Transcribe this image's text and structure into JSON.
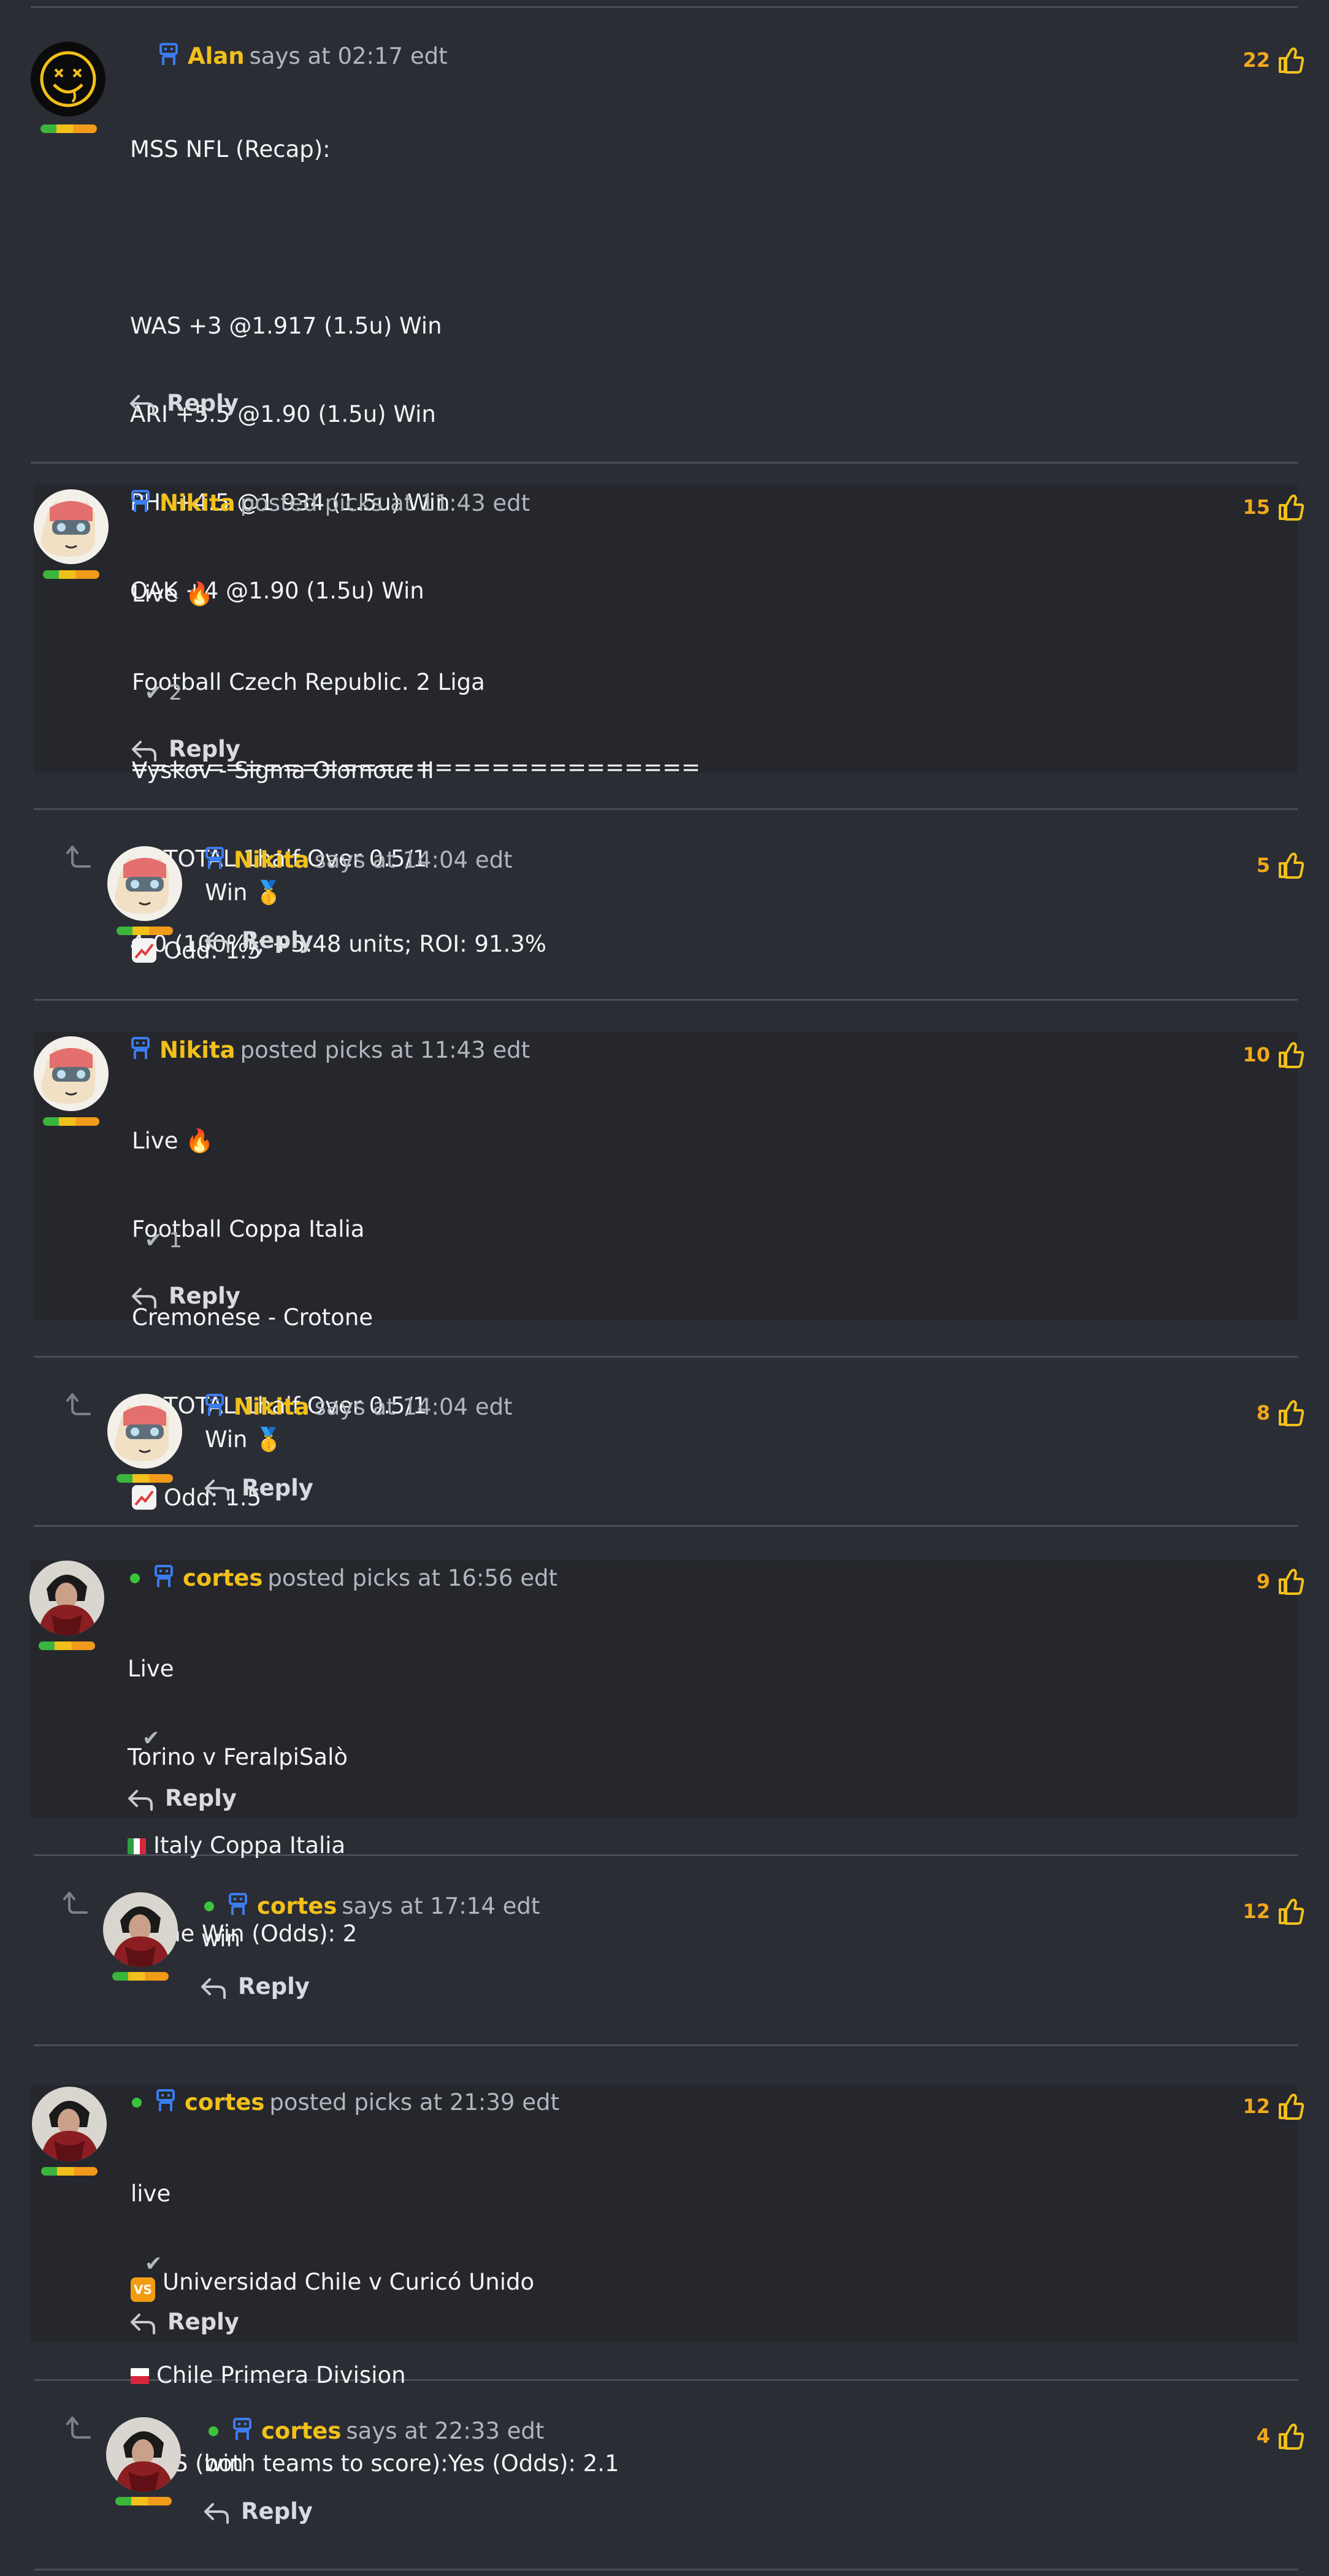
{
  "colors": {
    "background": "#2b2d35",
    "panel": "#25272d",
    "username": "#f2c01a",
    "likes": "#f2a81a",
    "online": "#3bc43b"
  },
  "icons": {
    "reply": "reply-arrow-icon",
    "like": "thumbs-up-icon",
    "bot": "robot-icon",
    "nested": "nested-reply-arrow-icon",
    "check": "checkmark-icon"
  },
  "comments": [
    {
      "user": "Alan",
      "action": "says at 02:17 edt",
      "likes": "22",
      "lines": [
        "MSS NFL (Recap):",
        "",
        "WAS +3 @1.917 (1.5u) Win",
        "ARI +5.5 @1.90 (1.5u) Win",
        "PHI +4.5 @1.934 (1.5u) Win",
        "OAK +4 @1.90 (1.5u) Win",
        "",
        "==============================",
        "",
        "4-0 (100%); +5.48 units; ROI: 91.3%"
      ],
      "reply": "Reply"
    },
    {
      "user": "Nikita",
      "action": "posted picks at 11:43 edt",
      "likes": "15",
      "lines": [
        "Live 🔥",
        "Football Czech Republic. 2 Liga",
        "Vyskov - Sigma Olomouc II",
        "TOTAL 1half Over 0.5/1",
        "Odd: 1.5"
      ],
      "checks": "2",
      "reply": "Reply"
    },
    {
      "user": "Nikita",
      "action": "says at 14:04 edt",
      "likes": "5",
      "lines": [
        "Win 🥇"
      ],
      "reply": "Reply"
    },
    {
      "user": "Nikita",
      "action": "posted picks at 11:43 edt",
      "likes": "10",
      "lines": [
        "Live 🔥",
        "Football Coppa Italia",
        "Cremonese - Crotone",
        "TOTAL 1half Over 0.5/1",
        "Odd: 1.5"
      ],
      "checks": "1",
      "reply": "Reply"
    },
    {
      "user": "Nikita",
      "action": "says at 14:04 edt",
      "likes": "8",
      "lines": [
        "Win 🥇"
      ],
      "reply": "Reply"
    },
    {
      "user": "cortes",
      "action": "posted picks at 16:56 edt",
      "likes": "9",
      "lines": [
        "Live",
        "Torino v FeralpiSalò",
        "Italy Coppa Italia",
        "Home Win (Odds): 2"
      ],
      "reply": "Reply"
    },
    {
      "user": "cortes",
      "action": "says at 17:14 edt",
      "likes": "12",
      "lines": [
        "win"
      ],
      "reply": "Reply"
    },
    {
      "user": "cortes",
      "action": "posted picks at 21:39 edt",
      "likes": "12",
      "lines": [
        "live",
        "Universidad Chile v Curicó Unido",
        "Chile Primera Division",
        "BTTS (both teams to score):Yes (Odds): 2.1"
      ],
      "reply": "Reply"
    },
    {
      "user": "cortes",
      "action": "says at 22:33 edt",
      "likes": "4",
      "lines": [
        "win"
      ],
      "reply": "Reply"
    }
  ]
}
